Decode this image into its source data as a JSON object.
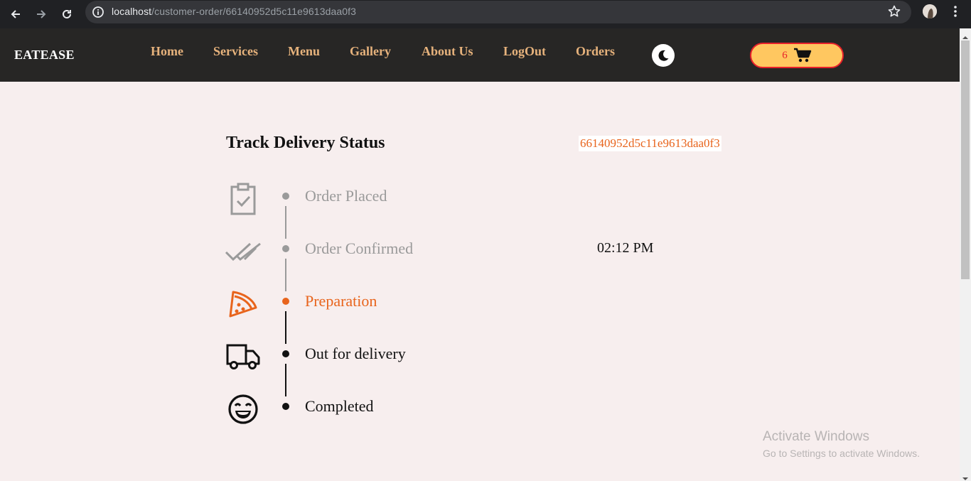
{
  "browser": {
    "url_host": "localhost",
    "url_path": "/customer-order/66140952d5c11e9613daa0f3"
  },
  "navbar": {
    "brand": "EATEASE",
    "links": [
      "Home",
      "Services",
      "Menu",
      "Gallery",
      "About Us",
      "LogOut",
      "Orders"
    ],
    "cart_count": "6"
  },
  "main": {
    "title": "Track Delivery Status",
    "order_id": "66140952d5c11e9613daa0f3",
    "statuses": [
      {
        "label": "Order Placed",
        "state": "done",
        "icon": "clipboard-check-icon"
      },
      {
        "label": "Order Confirmed",
        "state": "done",
        "icon": "double-check-icon"
      },
      {
        "label": "Preparation",
        "state": "current",
        "icon": "pizza-icon"
      },
      {
        "label": "Out for delivery",
        "state": "pending",
        "icon": "truck-icon"
      },
      {
        "label": "Completed",
        "state": "pending",
        "icon": "smile-icon"
      }
    ],
    "time": "02:12 PM"
  },
  "watermark": {
    "line1": "Activate Windows",
    "line2": "Go to Settings to activate Windows."
  },
  "colors": {
    "accent": "#e8641c",
    "done": "#9a9a9a",
    "nav_link": "#e6b27c",
    "cart_bg": "#ffc760",
    "cart_border": "#e8202a"
  }
}
